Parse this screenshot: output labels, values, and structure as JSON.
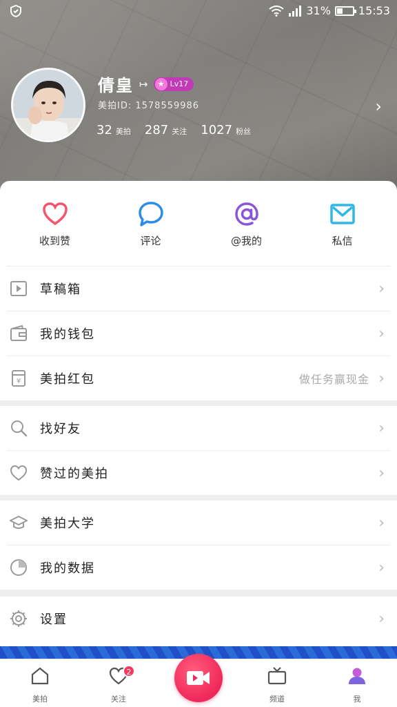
{
  "status_bar": {
    "battery": "31%",
    "time": "15:53"
  },
  "profile": {
    "name": "倩皇",
    "level": "Lv17",
    "id_text": "美拍ID: 1578559986",
    "stats": [
      {
        "count": "32",
        "label": "美拍"
      },
      {
        "count": "287",
        "label": "关注"
      },
      {
        "count": "1027",
        "label": "粉丝"
      }
    ]
  },
  "quick_actions": [
    {
      "label": "收到赞",
      "icon": "heart-icon",
      "color": "#f2556c"
    },
    {
      "label": "评论",
      "icon": "comment-icon",
      "color": "#2c8de8"
    },
    {
      "label": "@我的",
      "icon": "at-icon",
      "color": "#8a56d8"
    },
    {
      "label": "私信",
      "icon": "mail-icon",
      "color": "#2fb7e8"
    }
  ],
  "menu": {
    "drafts": "草稿箱",
    "wallet": "我的钱包",
    "red_packet": "美拍红包",
    "red_packet_hint": "做任务赢现金",
    "find_friends": "找好友",
    "liked": "赞过的美拍",
    "university": "美拍大学",
    "my_data": "我的数据",
    "settings": "设置"
  },
  "tabbar": {
    "home": "美拍",
    "follow": "关注",
    "follow_badge": "2",
    "channel": "频道",
    "me": "我"
  },
  "colors": {
    "accent": "#f0285a",
    "level_badge": "#c23ab6",
    "me_tab": "#9b59d0"
  }
}
